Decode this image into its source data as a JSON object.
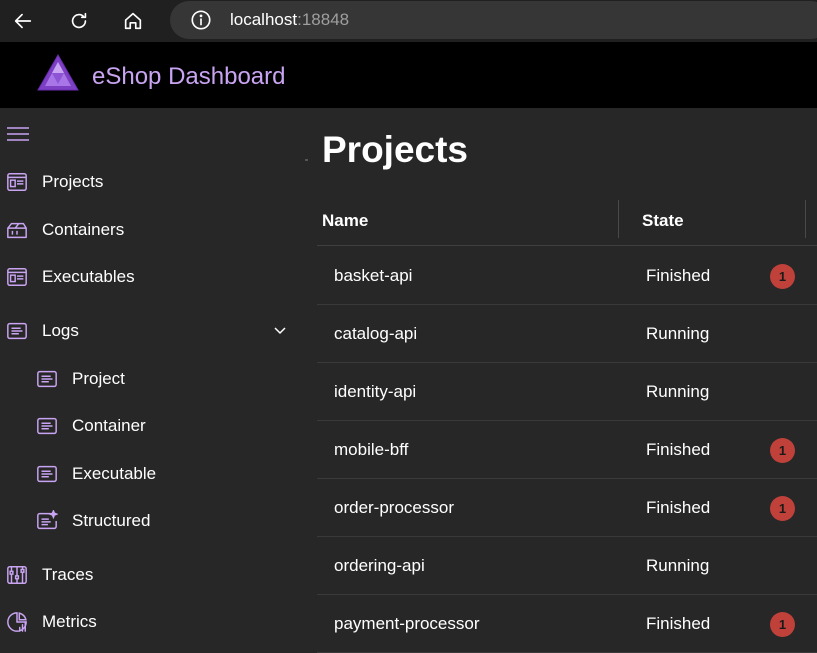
{
  "browser": {
    "url_host": "localhost",
    "url_port": ":18848"
  },
  "app": {
    "title": "eShop Dashboard"
  },
  "sidebar": {
    "items": [
      {
        "label": "Projects",
        "icon": "project-icon"
      },
      {
        "label": "Containers",
        "icon": "container-icon"
      },
      {
        "label": "Executables",
        "icon": "executable-icon"
      },
      {
        "label": "Logs",
        "icon": "logs-icon"
      }
    ],
    "logs_children": [
      {
        "label": "Project",
        "icon": "log-document-icon"
      },
      {
        "label": "Container",
        "icon": "log-document-icon"
      },
      {
        "label": "Executable",
        "icon": "log-document-icon"
      },
      {
        "label": "Structured",
        "icon": "structured-log-icon"
      }
    ],
    "bottom_items": [
      {
        "label": "Traces",
        "icon": "traces-icon"
      },
      {
        "label": "Metrics",
        "icon": "metrics-icon"
      }
    ]
  },
  "main": {
    "title": "Projects",
    "columns": {
      "name": "Name",
      "state": "State"
    },
    "rows": [
      {
        "name": "basket-api",
        "state": "Finished",
        "errors": "1"
      },
      {
        "name": "catalog-api",
        "state": "Running",
        "errors": ""
      },
      {
        "name": "identity-api",
        "state": "Running",
        "errors": ""
      },
      {
        "name": "mobile-bff",
        "state": "Finished",
        "errors": "1"
      },
      {
        "name": "order-processor",
        "state": "Finished",
        "errors": "1"
      },
      {
        "name": "ordering-api",
        "state": "Running",
        "errors": ""
      },
      {
        "name": "payment-processor",
        "state": "Finished",
        "errors": "1"
      }
    ]
  },
  "colors": {
    "accent": "#c9a4f2",
    "error_badge": "#c0403a"
  }
}
